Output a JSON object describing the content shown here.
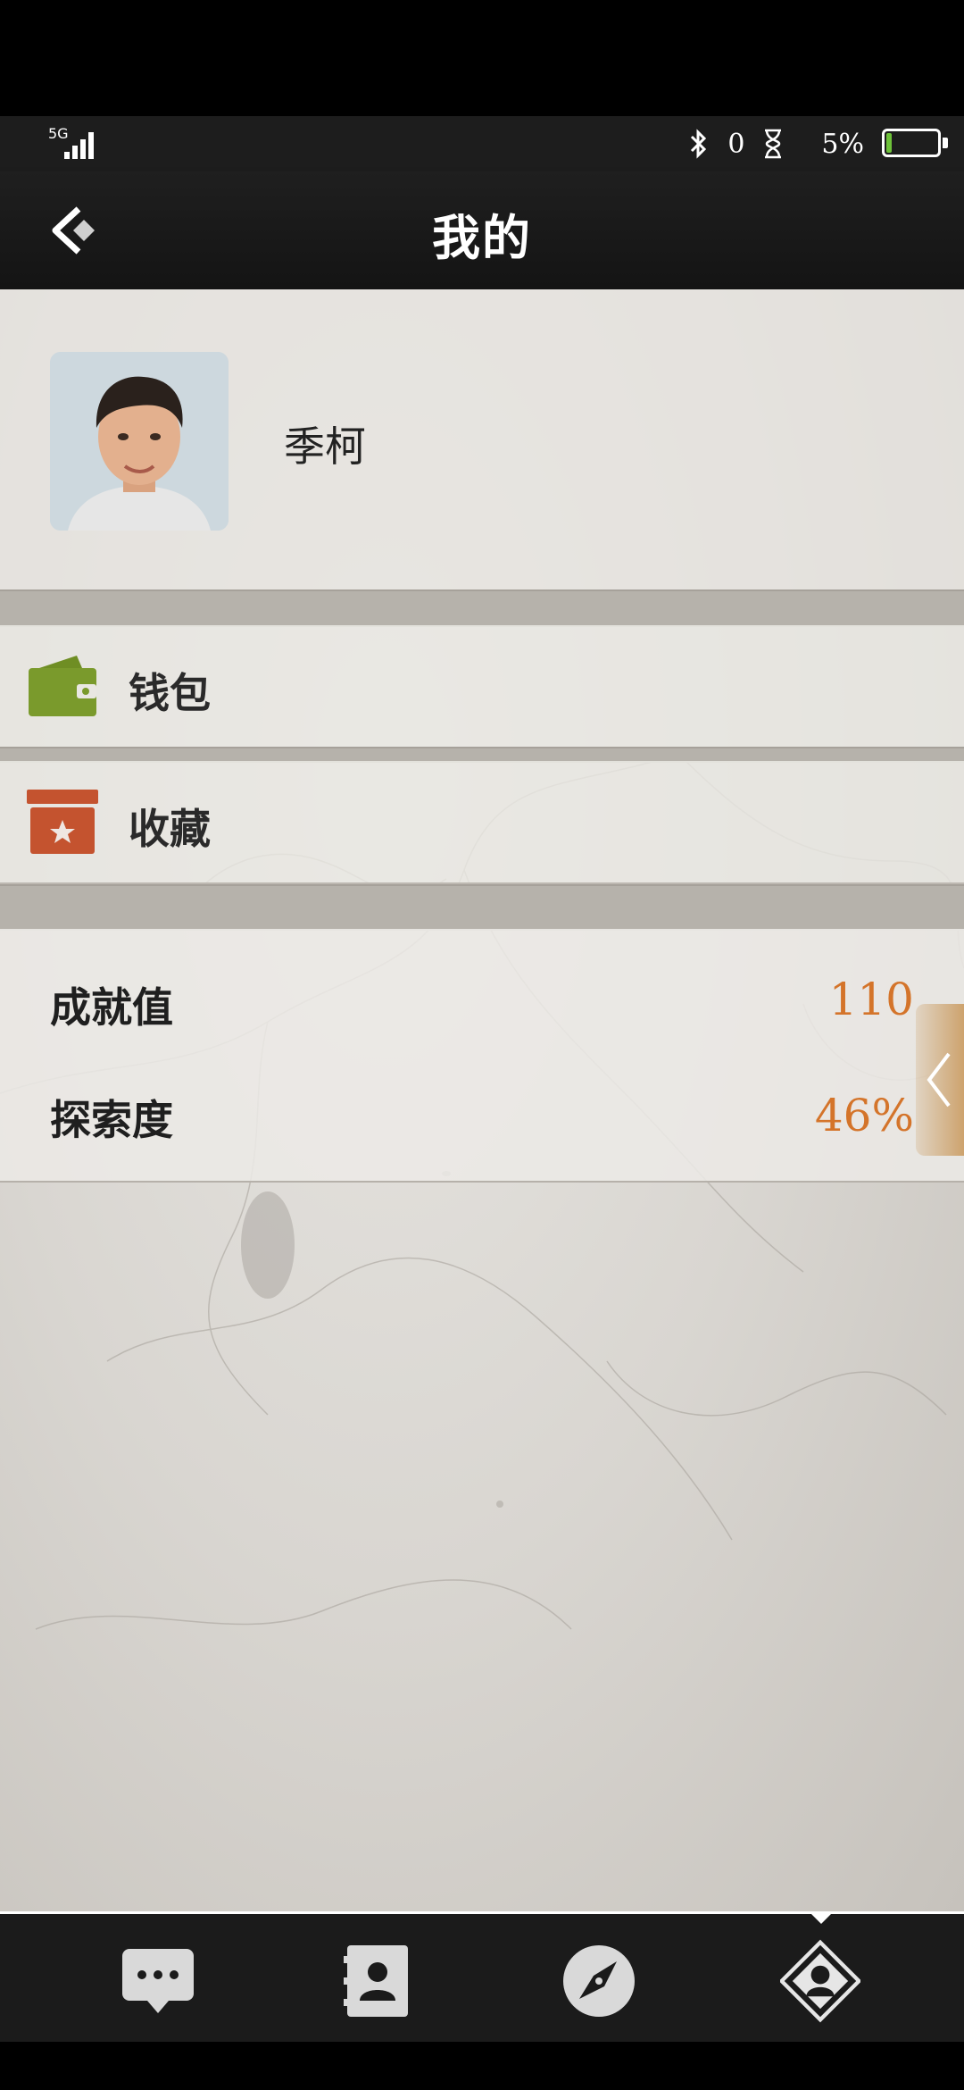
{
  "status_bar": {
    "network": "5G",
    "bluetooth_icon": "bluetooth-icon",
    "counter": "0",
    "hourglass_icon": "hourglass-icon",
    "battery_percent": "5%",
    "battery_level": 0.05
  },
  "header": {
    "title": "我的",
    "back_icon": "back-chevron-icon"
  },
  "profile": {
    "name": "季柯",
    "avatar_icon": "avatar-portrait"
  },
  "menu": {
    "items": [
      {
        "label": "钱包",
        "icon": "wallet-icon",
        "color": "#7a9a2c"
      },
      {
        "label": "收藏",
        "icon": "favorites-box-icon",
        "color": "#c4532f"
      }
    ]
  },
  "stats": {
    "achievement_label": "成就值",
    "achievement_value": "110",
    "exploration_label": "探索度",
    "exploration_value": "46%",
    "value_color": "#d4742a"
  },
  "bottom_nav": {
    "items": [
      {
        "icon": "messages-icon"
      },
      {
        "icon": "contacts-icon"
      },
      {
        "icon": "compass-icon"
      },
      {
        "icon": "profile-diamond-icon",
        "active": true
      }
    ]
  }
}
